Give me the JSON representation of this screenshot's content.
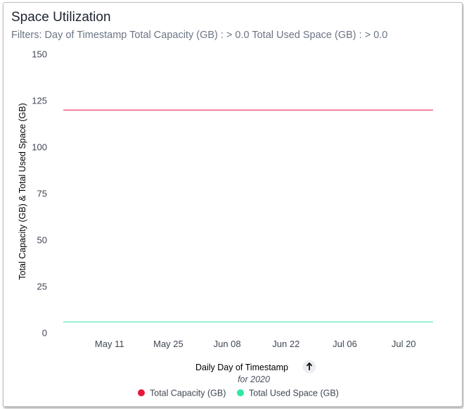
{
  "title": "Space Utilization",
  "filters": "Filters: Day of Timestamp Total Capacity (GB) : > 0.0 Total Used Space (GB) : > 0.0",
  "chart_data": {
    "type": "line",
    "xlabel": "Daily Day of Timestamp",
    "xlabel_sub": "for 2020",
    "ylabel": "Total Capacity (GB) & Total Used Space (GB)",
    "ylim": [
      0,
      150
    ],
    "yticks": [
      0,
      25,
      50,
      75,
      100,
      125,
      150
    ],
    "x_range": [
      "2020-04-30",
      "2020-07-29"
    ],
    "xticks": [
      {
        "date": "2020-05-11",
        "label": "May 11"
      },
      {
        "date": "2020-05-25",
        "label": "May 25"
      },
      {
        "date": "2020-06-08",
        "label": "Jun 08"
      },
      {
        "date": "2020-06-22",
        "label": "Jun 22"
      },
      {
        "date": "2020-07-06",
        "label": "Jul 06"
      },
      {
        "date": "2020-07-20",
        "label": "Jul 20"
      }
    ],
    "series": [
      {
        "name": "Total Capacity (GB)",
        "color": "#e8163d",
        "x": [
          "2020-04-30",
          "2020-07-27"
        ],
        "values": [
          120,
          120
        ]
      },
      {
        "name": "Total Used Space (GB)",
        "color": "#2ee8a4",
        "x": [
          "2020-04-30",
          "2020-07-27"
        ],
        "values": [
          6,
          6
        ]
      }
    ],
    "legend_position": "bottom",
    "sort_icon": "arrow-up-icon"
  }
}
